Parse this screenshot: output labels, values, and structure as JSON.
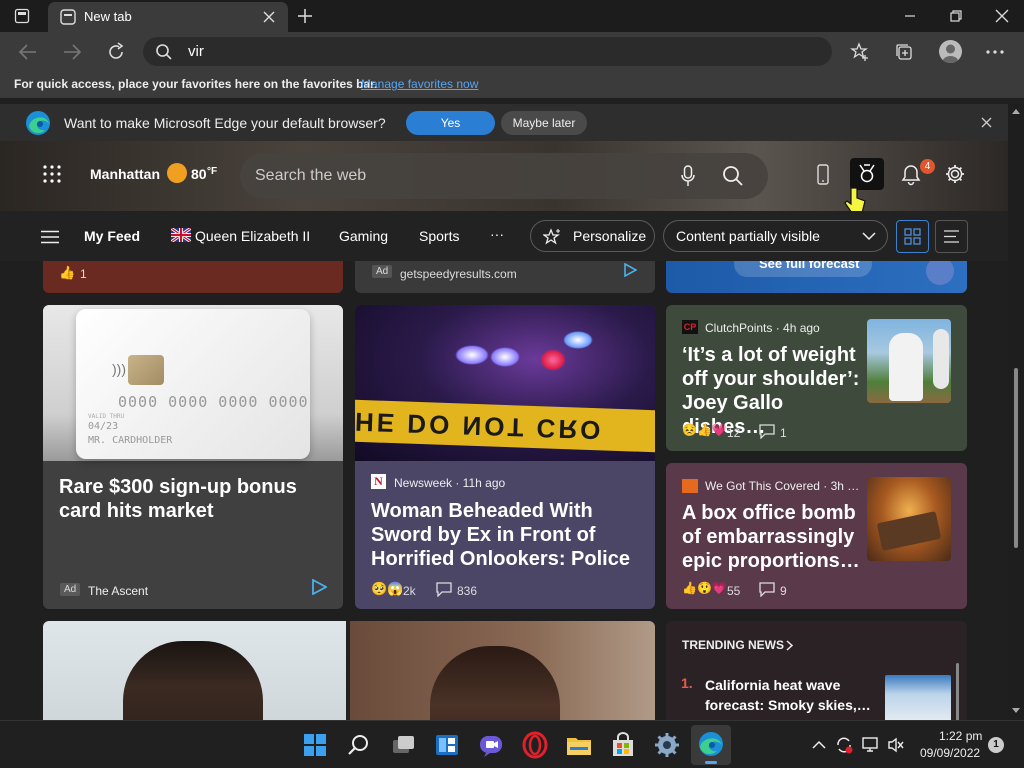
{
  "browser": {
    "tab_title": "New tab",
    "address_value": "vir",
    "favorites_bar_text": "For quick access, place your favorites here on the favorites bar.",
    "favorites_link": "Manage favorites now"
  },
  "banner": {
    "message": "Want to make Microsoft Edge your default browser?",
    "yes_label": "Yes",
    "later_label": "Maybe later"
  },
  "header": {
    "location": "Manhattan",
    "temperature": "80",
    "temp_unit": "°F",
    "search_placeholder": "Search the web",
    "notification_count": "4"
  },
  "feed_nav": {
    "items": [
      "My Feed",
      "Queen Elizabeth II",
      "Gaming",
      "Sports"
    ],
    "more": "···",
    "personalize": "Personalize",
    "visibility_select": "Content partially visible"
  },
  "top_strip": {
    "left_likes": "1",
    "ad_badge": "Ad",
    "ad_source": "getspeedyresults.com",
    "forecast_button": "See full forecast"
  },
  "cards": {
    "card1": {
      "card_number": "0000 0000 0000 0000",
      "card_valid": "VALID THRU",
      "card_date": "04/23",
      "card_holder": "MR. CARDHOLDER",
      "title": "Rare $300 sign-up bonus card hits market",
      "ad_badge": "Ad",
      "source": "The Ascent"
    },
    "card2": {
      "tape_text": "HE DO NOT CRO",
      "source": "Newsweek · 11h ago",
      "title": "Woman Beheaded With Sword by Ex in Front of Horrified Onlookers: Police",
      "reactions": "2k",
      "comments": "836"
    },
    "card3": {
      "source": "ClutchPoints · 4h ago",
      "title": "‘It’s a lot of weight off your shoulder’: Joey Gallo dishes…",
      "reactions": "12",
      "comments": "1"
    },
    "card4": {
      "source": "We Got This Covered · 3h …",
      "title": "A box office bomb of embarrassingly epic proportions…",
      "reactions": "55",
      "comments": "9"
    }
  },
  "trending": {
    "header": "TRENDING NEWS",
    "items": [
      {
        "rank": "1.",
        "title": "California heat wave forecast: Smoky skies,…"
      }
    ]
  },
  "taskbar": {
    "time": "1:22 pm",
    "date": "09/09/2022",
    "notification_badge": "1"
  },
  "colors": {
    "accent": "#2a7fd4",
    "badge": "#e0572f",
    "weather_sun": "#f0a020"
  }
}
